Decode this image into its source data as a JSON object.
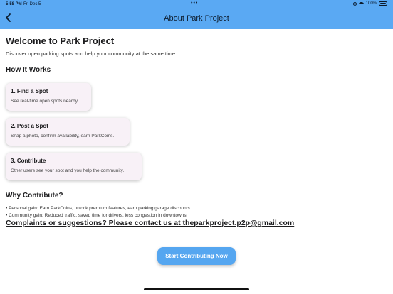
{
  "status_bar": {
    "time": "5:58 PM",
    "date": "Fri Dec 5",
    "dots": "•••",
    "battery_percent": "100%"
  },
  "nav": {
    "title": "About Park Project",
    "back_icon": "chevron-left-icon"
  },
  "main": {
    "title": "Welcome to Park Project",
    "intro": "Discover open parking spots and help your community at the same time.",
    "how_heading": "How It Works",
    "steps": [
      {
        "title": "1. Find a Spot",
        "desc": "See real-time open spots nearby."
      },
      {
        "title": "2. Post a Spot",
        "desc": "Snap a photo, confirm availability, earn ParkCoins."
      },
      {
        "title": "3. Contribute",
        "desc": "Other users see your spot and you help the community."
      }
    ],
    "why_heading": "Why Contribute?",
    "bullets": [
      "• Personal gain: Earn ParkCoins, unlock premium features, earn parking garage discounts.",
      "• Community gain: Reduced traffic, saved time for drivers, less congestion in downtowns."
    ],
    "contact": "Complaints or suggestions? Please contact us at theparkproject.p2p@gmail.com",
    "cta_label": "Start Contributing Now"
  },
  "colors": {
    "header_bg": "#5aa9f3",
    "card_bg": "#f8f1f7",
    "cta_bg": "#55a6f0"
  }
}
